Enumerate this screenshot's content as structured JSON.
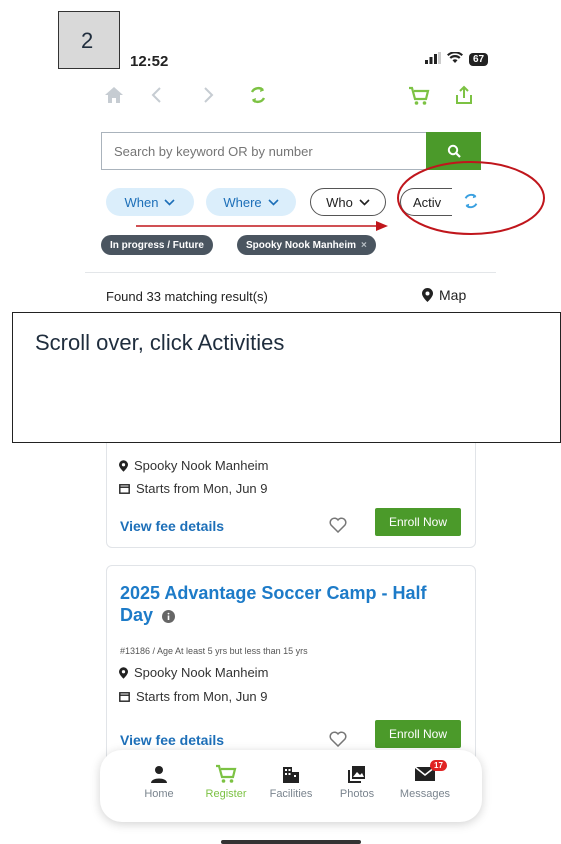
{
  "step_label": "2",
  "status_bar": {
    "time": "12:52",
    "battery": "67"
  },
  "search": {
    "placeholder": "Search by keyword OR by number"
  },
  "filters": [
    {
      "label": "When"
    },
    {
      "label": "Where"
    },
    {
      "label": "Who"
    },
    {
      "label": "Activ"
    }
  ],
  "active_tags": [
    "In progress / Future",
    "Spooky Nook Manheim"
  ],
  "results": {
    "found_text": "Found 33 matching result(s)",
    "map_label": "Map"
  },
  "callout_text": "Scroll over, click Activities",
  "card1": {
    "location": "Spooky Nook Manheim",
    "start": "Starts from Mon, Jun 9",
    "fee_link": "View fee details",
    "enroll_label": "Enroll Now"
  },
  "card2": {
    "title": "2025 Advantage Soccer Camp - Half Day",
    "meta": "#13186 / Age At least 5 yrs but less than 15 yrs",
    "location": "Spooky Nook Manheim",
    "start": "Starts from Mon, Jun 9",
    "fee_link": "View fee details",
    "enroll_label": "Enroll Now"
  },
  "tabbar": {
    "items": [
      {
        "label": "Home",
        "icon": "person-icon"
      },
      {
        "label": "Register",
        "icon": "cart-icon"
      },
      {
        "label": "Facilities",
        "icon": "building-icon"
      },
      {
        "label": "Photos",
        "icon": "photos-icon"
      },
      {
        "label": "Messages",
        "icon": "mail-icon"
      }
    ],
    "messages_badge": "17"
  },
  "colors": {
    "accent_green": "#4b9a2a",
    "link_blue": "#1d7bc8",
    "annotation_red": "#c0161c"
  }
}
